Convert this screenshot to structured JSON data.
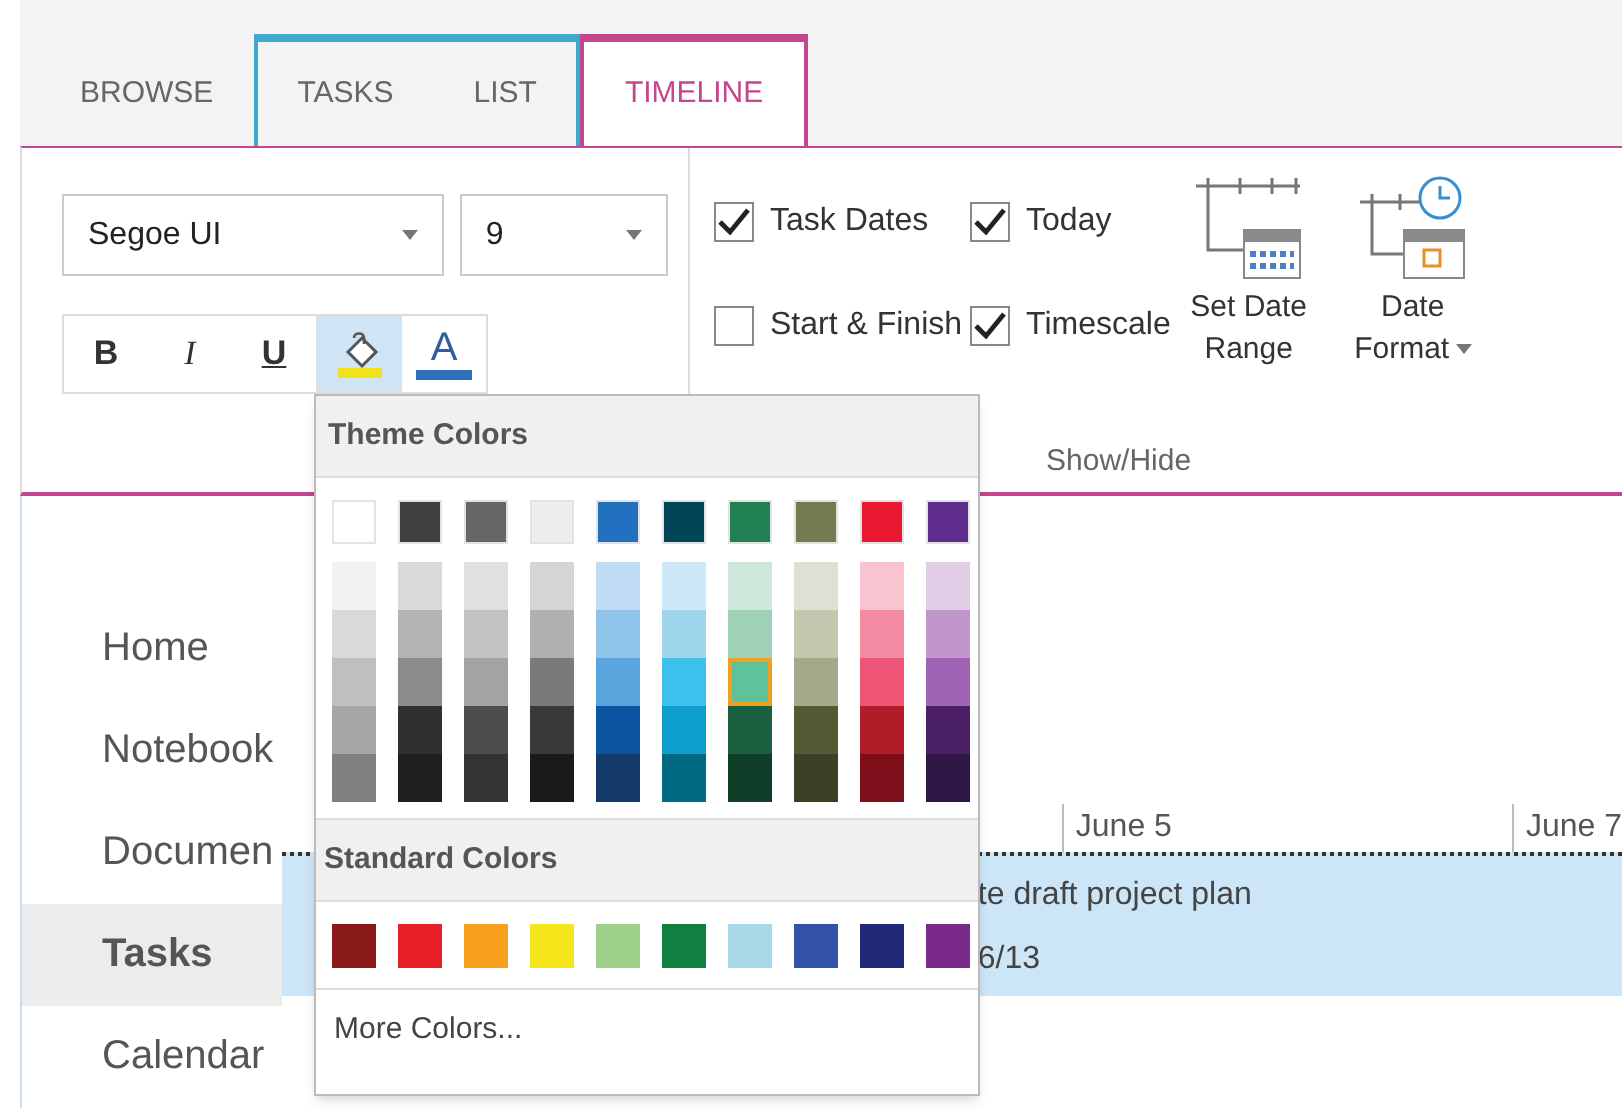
{
  "ribbon": {
    "tab_groups": [
      {
        "tabs": [
          {
            "label": "BROWSE",
            "selected": false
          }
        ]
      },
      {
        "color": "#3fa9d0",
        "tabs": [
          {
            "label": "TASKS",
            "selected": false
          },
          {
            "label": "LIST",
            "selected": false
          }
        ]
      },
      {
        "color": "#c4468f",
        "tabs": [
          {
            "label": "TIMELINE",
            "selected": true
          }
        ]
      }
    ],
    "font_group": {
      "font": "Segoe UI",
      "size": "9",
      "format_buttons": [
        {
          "label": "B",
          "kind": "bold"
        },
        {
          "label": "I",
          "kind": "italic"
        },
        {
          "label": "U",
          "kind": "underline"
        }
      ],
      "highlight_button": {
        "color": "#f2e21c",
        "selected": true
      },
      "font_color_button": {
        "label": "A",
        "color": "#2f6fb8"
      }
    },
    "show_hide_group": {
      "label": "Show/Hide",
      "checkboxes": [
        {
          "label": "Task Dates",
          "checked": true
        },
        {
          "label": "Today",
          "checked": true
        },
        {
          "label": "Start & Finish",
          "checked": false
        },
        {
          "label": "Timescale",
          "checked": true
        }
      ],
      "buttons": [
        {
          "label_lines": [
            "Set Date",
            "Range"
          ],
          "kind": "range",
          "dropdown": false
        },
        {
          "label_lines": [
            "Date",
            "Format"
          ],
          "kind": "format",
          "dropdown": true
        }
      ]
    }
  },
  "sidebar": {
    "items": [
      {
        "label": "Home",
        "selected": false
      },
      {
        "label": "Notebook",
        "selected": false
      },
      {
        "label": "Documen",
        "selected": false
      },
      {
        "label": "Tasks",
        "selected": true
      },
      {
        "label": "Calendar",
        "selected": false
      }
    ]
  },
  "timeline": {
    "dates": [
      "June 5",
      "June 7"
    ],
    "task": {
      "title": "te draft project plan",
      "dates": "6/13"
    }
  },
  "color_picker": {
    "theme_title": "Theme Colors",
    "theme_colors": [
      {
        "color": "#ffffff",
        "shades": [
          {
            "color": "#f2f2f2",
            "selected": false
          },
          {
            "color": "#d9d9d9",
            "selected": false
          },
          {
            "color": "#bfbfbf",
            "selected": false
          },
          {
            "color": "#a6a6a6",
            "selected": false
          },
          {
            "color": "#808080",
            "selected": false
          }
        ]
      },
      {
        "color": "#404040",
        "shades": [
          {
            "color": "#d9d9d9",
            "selected": false
          },
          {
            "color": "#b3b3b3",
            "selected": false
          },
          {
            "color": "#8c8c8c",
            "selected": false
          },
          {
            "color": "#303030",
            "selected": false
          },
          {
            "color": "#202020",
            "selected": false
          }
        ]
      },
      {
        "color": "#666666",
        "shades": [
          {
            "color": "#e0e0e0",
            "selected": false
          },
          {
            "color": "#c2c2c2",
            "selected": false
          },
          {
            "color": "#a3a3a3",
            "selected": false
          },
          {
            "color": "#4d4d4d",
            "selected": false
          },
          {
            "color": "#333333",
            "selected": false
          }
        ]
      },
      {
        "color": "#ededed",
        "shades": [
          {
            "color": "#d5d5d5",
            "selected": false
          },
          {
            "color": "#b0b0b0",
            "selected": false
          },
          {
            "color": "#7a7a7a",
            "selected": false
          },
          {
            "color": "#3a3a3a",
            "selected": false
          },
          {
            "color": "#1a1a1a",
            "selected": false
          }
        ]
      },
      {
        "color": "#2270c0",
        "shades": [
          {
            "color": "#bfdcf4",
            "selected": false
          },
          {
            "color": "#8ec3ea",
            "selected": false
          },
          {
            "color": "#5aa5dd",
            "selected": false
          },
          {
            "color": "#0b55a0",
            "selected": false
          },
          {
            "color": "#133a6a",
            "selected": false
          }
        ]
      },
      {
        "color": "#004557",
        "shades": [
          {
            "color": "#cde9f7",
            "selected": false
          },
          {
            "color": "#9fd6ee",
            "selected": false
          },
          {
            "color": "#3fc1ee",
            "selected": false
          },
          {
            "color": "#0d9fcb",
            "selected": false
          },
          {
            "color": "#006a84",
            "selected": false
          }
        ]
      },
      {
        "color": "#218051",
        "shades": [
          {
            "color": "#cde8da",
            "selected": false
          },
          {
            "color": "#9fd1b9",
            "selected": false
          },
          {
            "color": "#5ec39a",
            "selected": true
          },
          {
            "color": "#1a6040",
            "selected": false
          },
          {
            "color": "#0f3f28",
            "selected": false
          }
        ]
      },
      {
        "color": "#737b4f",
        "shades": [
          {
            "color": "#dfe0d5",
            "selected": false
          },
          {
            "color": "#c4c6ae",
            "selected": false
          },
          {
            "color": "#a4a98a",
            "selected": false
          },
          {
            "color": "#545a36",
            "selected": false
          },
          {
            "color": "#3b3f26",
            "selected": false
          }
        ]
      },
      {
        "color": "#e81930",
        "shades": [
          {
            "color": "#f9c4cf",
            "selected": false
          },
          {
            "color": "#f38ca2",
            "selected": false
          },
          {
            "color": "#ee5475",
            "selected": false
          },
          {
            "color": "#b01c28",
            "selected": false
          },
          {
            "color": "#7d0f1b",
            "selected": false
          }
        ]
      },
      {
        "color": "#5f2d8c",
        "shades": [
          {
            "color": "#e2cde6",
            "selected": false
          },
          {
            "color": "#c196cc",
            "selected": false
          },
          {
            "color": "#9e63b2",
            "selected": false
          },
          {
            "color": "#4a1f66",
            "selected": false
          },
          {
            "color": "#2e1744",
            "selected": false
          }
        ]
      }
    ],
    "standard_title": "Standard Colors",
    "standard_colors": [
      {
        "color": "#8b1a1a"
      },
      {
        "color": "#e8202a"
      },
      {
        "color": "#f7a01c"
      },
      {
        "color": "#f4e61a"
      },
      {
        "color": "#9ed08a"
      },
      {
        "color": "#108040"
      },
      {
        "color": "#a8d8e8"
      },
      {
        "color": "#3353a8"
      },
      {
        "color": "#202a78"
      },
      {
        "color": "#7a2a88"
      }
    ],
    "more_colors": "More Colors..."
  }
}
